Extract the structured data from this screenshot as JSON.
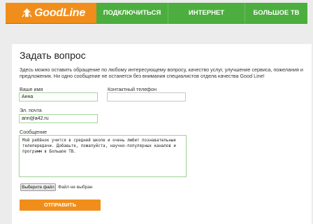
{
  "header": {
    "logo_text": "GoodLine",
    "logo_icon": "arrow-burst-icon",
    "nav": [
      {
        "label": "ПОДКЛЮЧИТЬСЯ"
      },
      {
        "label": "ИНТЕРНЕТ"
      },
      {
        "label": "БОЛЬШОЕ ТВ"
      }
    ]
  },
  "form": {
    "title": "Задать вопрос",
    "intro": "Здесь можно оставить обращение по любому интересующему вопросу, качество услуг, улучшение сервиса, пожелания и предложения. Ни одно сообщение не останется без внимания специалистов отдела качества Good Line!",
    "name_label": "Ваше имя",
    "name_value": "Анна",
    "phone_label": "Контактный телефон",
    "phone_value": "",
    "email_label": "Эл. почта",
    "email_value": "ann@a42.ru",
    "message_label": "Сообщение",
    "message_value": "Мой ребёнок учится в средней школе и очень любит познавательные телепередачи. Добавьте, пожалуйста, научно-популярных каналов и программ в Большое ТВ.",
    "file_button": "Выберите файл",
    "file_status": "Файл не выбран",
    "submit": "ОТПРАВИТЬ"
  },
  "colors": {
    "brand_orange": "#f18e1b",
    "brand_green": "#4cae3e",
    "field_focus_border": "#a8d49d"
  }
}
